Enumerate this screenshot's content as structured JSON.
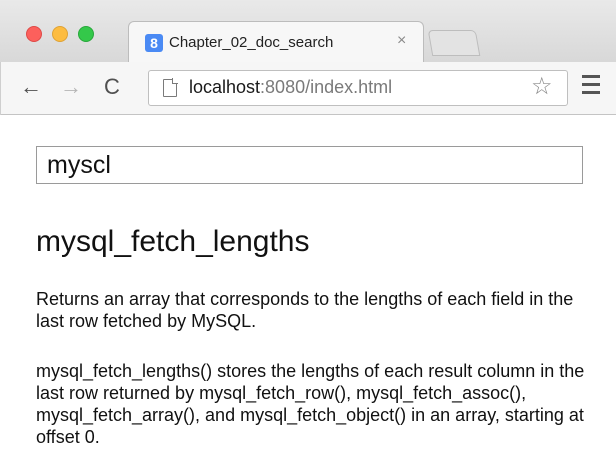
{
  "browser": {
    "tab": {
      "favicon": "8",
      "title": "Chapter_02_doc_search",
      "close_glyph": "×"
    },
    "toolbar": {
      "back_glyph": "←",
      "forward_glyph": "→",
      "reload_glyph": "C",
      "url_host": "localhost",
      "url_rest": ":8080/index.html",
      "star_glyph": "☆"
    }
  },
  "page": {
    "search": {
      "value": "myscl"
    },
    "result": {
      "title": "mysql_fetch_lengths",
      "summary": "Returns an array that corresponds to the lengths of each field in the last row fetched by MySQL.",
      "detail": "mysql_fetch_lengths() stores the lengths of each result column in the last row returned by mysql_fetch_row(), mysql_fetch_assoc(), mysql_fetch_array(), and mysql_fetch_object() in an array, starting at offset 0."
    }
  },
  "colors": {
    "close": "#fc605c",
    "minimize": "#fdbc40",
    "zoom": "#34c84a",
    "favicon": "#4a8af4"
  },
  "icons": {
    "close": "close-icon",
    "minimize": "minimize-icon",
    "zoom": "zoom-icon",
    "page": "page-icon",
    "bookmark": "star-icon",
    "menu": "hamburger-menu-icon"
  }
}
